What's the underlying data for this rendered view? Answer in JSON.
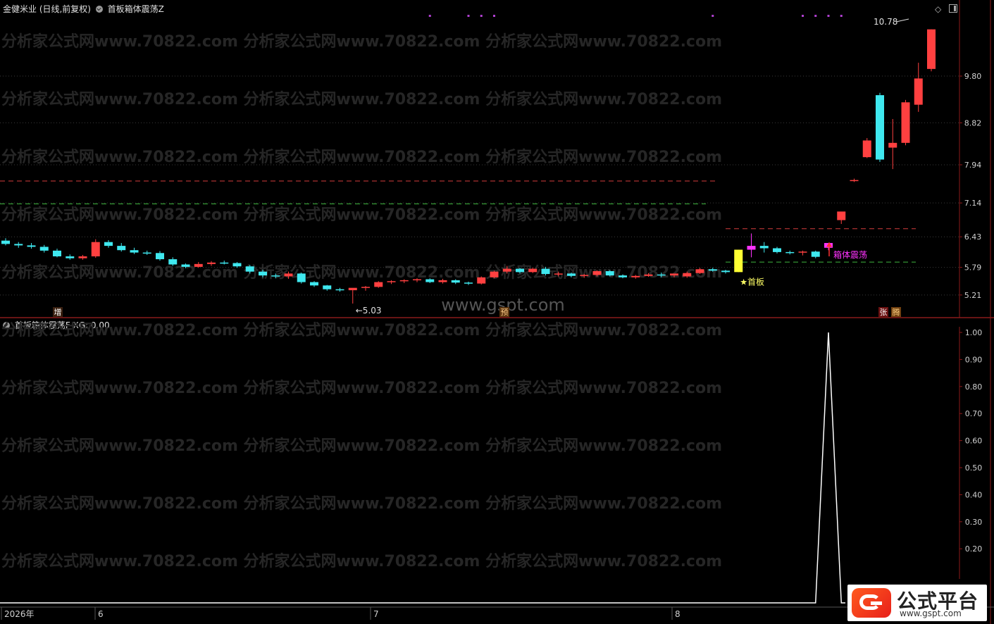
{
  "upper": {
    "title_stock": "金健米业 (日线,前复权)",
    "title_indicator": "首板箱体震荡Z"
  },
  "lower": {
    "title": "首板箱体震荡F  XG: 0.00"
  },
  "watermark": {
    "line": "分析家公式网www.70822.com  分析家公式网www.70822.com  分析家公式网www.70822.com",
    "center": "www.gspt.com"
  },
  "logo": {
    "title": "公式平台",
    "url": "www.gspt.com"
  },
  "colors": {
    "up": "#ff4040",
    "down": "#3fe8ef",
    "first_board": "#ffff33",
    "box": "#ff33ff",
    "resistance": "#d43c3c",
    "support": "#3fb53f",
    "axis": "#8b1a1a",
    "xg_line": "#ffffff"
  },
  "chart_data": [
    {
      "type": "candlestick",
      "y_axis_ticks": [
        "9.80",
        "8.82",
        "7.94",
        "7.14",
        "6.43",
        "5.79",
        "5.21"
      ],
      "ylim": [
        4.75,
        11.1
      ],
      "x_axis_labels": [
        "2026年",
        "6",
        "7",
        "8"
      ],
      "resistance_levels": [
        7.6,
        6.6
      ],
      "support_levels": [
        7.12,
        5.9
      ],
      "ohlc": [
        [
          6.35,
          6.4,
          6.25,
          6.28
        ],
        [
          6.28,
          6.32,
          6.2,
          6.25
        ],
        [
          6.25,
          6.3,
          6.18,
          6.22
        ],
        [
          6.22,
          6.26,
          6.1,
          6.14
        ],
        [
          6.14,
          6.18,
          6.0,
          6.02
        ],
        [
          6.02,
          6.06,
          5.95,
          5.98
        ],
        [
          5.98,
          6.05,
          5.95,
          6.02
        ],
        [
          6.02,
          6.38,
          5.99,
          6.32
        ],
        [
          6.32,
          6.36,
          6.2,
          6.24
        ],
        [
          6.24,
          6.3,
          6.12,
          6.15
        ],
        [
          6.15,
          6.2,
          6.07,
          6.1
        ],
        [
          6.1,
          6.14,
          6.05,
          6.09
        ],
        [
          6.09,
          6.13,
          5.93,
          5.96
        ],
        [
          5.96,
          6.0,
          5.82,
          5.85
        ],
        [
          5.85,
          5.87,
          5.77,
          5.8
        ],
        [
          5.8,
          5.9,
          5.78,
          5.86
        ],
        [
          5.86,
          5.92,
          5.82,
          5.89
        ],
        [
          5.89,
          5.93,
          5.85,
          5.88
        ],
        [
          5.88,
          5.9,
          5.78,
          5.81
        ],
        [
          5.81,
          5.84,
          5.66,
          5.7
        ],
        [
          5.7,
          5.74,
          5.58,
          5.62
        ],
        [
          5.62,
          5.66,
          5.56,
          5.6
        ],
        [
          5.6,
          5.7,
          5.55,
          5.66
        ],
        [
          5.66,
          5.68,
          5.45,
          5.48
        ],
        [
          5.48,
          5.5,
          5.38,
          5.41
        ],
        [
          5.41,
          5.42,
          5.3,
          5.33
        ],
        [
          5.33,
          5.36,
          5.28,
          5.31
        ],
        [
          5.31,
          5.34,
          5.03,
          5.36
        ],
        [
          5.36,
          5.4,
          5.3,
          5.38
        ],
        [
          5.38,
          5.5,
          5.36,
          5.48
        ],
        [
          5.48,
          5.52,
          5.44,
          5.5
        ],
        [
          5.5,
          5.54,
          5.46,
          5.52
        ],
        [
          5.52,
          5.56,
          5.48,
          5.54
        ],
        [
          5.54,
          5.56,
          5.46,
          5.48
        ],
        [
          5.48,
          5.55,
          5.45,
          5.52
        ],
        [
          5.52,
          5.54,
          5.44,
          5.47
        ],
        [
          5.47,
          5.49,
          5.42,
          5.45
        ],
        [
          5.45,
          5.6,
          5.43,
          5.58
        ],
        [
          5.58,
          5.72,
          5.56,
          5.7
        ],
        [
          5.7,
          5.82,
          5.66,
          5.76
        ],
        [
          5.76,
          5.78,
          5.66,
          5.69
        ],
        [
          5.69,
          5.78,
          5.67,
          5.76
        ],
        [
          5.76,
          5.8,
          5.62,
          5.65
        ],
        [
          5.65,
          5.7,
          5.6,
          5.66
        ],
        [
          5.66,
          5.68,
          5.58,
          5.61
        ],
        [
          5.61,
          5.65,
          5.57,
          5.63
        ],
        [
          5.63,
          5.73,
          5.6,
          5.71
        ],
        [
          5.71,
          5.73,
          5.6,
          5.62
        ],
        [
          5.62,
          5.64,
          5.56,
          5.58
        ],
        [
          5.58,
          5.63,
          5.55,
          5.61
        ],
        [
          5.61,
          5.67,
          5.59,
          5.64
        ],
        [
          5.64,
          5.68,
          5.58,
          5.62
        ],
        [
          5.62,
          5.64,
          5.58,
          5.66
        ],
        [
          5.6,
          5.7,
          5.57,
          5.67
        ],
        [
          5.67,
          5.78,
          5.65,
          5.75
        ],
        [
          5.75,
          5.78,
          5.7,
          5.72
        ],
        [
          5.72,
          5.74,
          5.66,
          5.69
        ],
        [
          5.69,
          6.16,
          5.69,
          6.16
        ],
        [
          6.16,
          6.5,
          6.0,
          6.24
        ],
        [
          6.24,
          6.32,
          6.1,
          6.19
        ],
        [
          6.19,
          6.22,
          6.08,
          6.11
        ],
        [
          6.11,
          6.14,
          6.06,
          6.1
        ],
        [
          6.1,
          6.14,
          6.04,
          6.12
        ],
        [
          6.12,
          6.14,
          5.98,
          6.01
        ],
        [
          6.2,
          6.25,
          6.15,
          6.3
        ],
        [
          6.78,
          6.92,
          6.7,
          6.96
        ],
        [
          7.6,
          7.65,
          7.58,
          7.62
        ],
        [
          8.1,
          8.5,
          8.08,
          8.45
        ],
        [
          9.4,
          9.45,
          8.0,
          8.05
        ],
        [
          8.3,
          8.9,
          7.85,
          8.4
        ],
        [
          8.4,
          9.3,
          8.35,
          9.25
        ],
        [
          9.2,
          10.08,
          9.05,
          9.75
        ],
        [
          9.95,
          10.78,
          9.9,
          10.78
        ]
      ],
      "annotations": {
        "low": "←5.03",
        "first_board": "★首板",
        "box": "箱体震荡",
        "peak": "10.78",
        "marker_zeng": "增",
        "marker_yu": "预",
        "marker_zhang": "张",
        "marker_teng": "腾"
      }
    },
    {
      "type": "line",
      "series": [
        {
          "name": "XG",
          "spike_index": 64,
          "values_nonzero": 1.0
        }
      ],
      "y_axis_ticks": [
        "1.00",
        "0.90",
        "0.80",
        "0.70",
        "0.60",
        "0.50",
        "0.40",
        "0.30",
        "0.20"
      ],
      "ylim": [
        0,
        1.0
      ]
    }
  ]
}
